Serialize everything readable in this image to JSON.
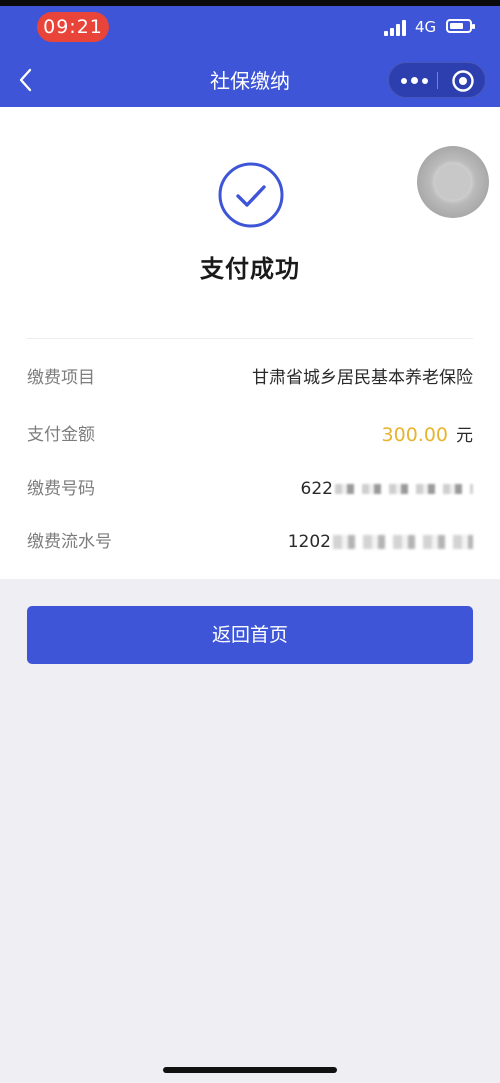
{
  "status_bar": {
    "time": "09:21",
    "network": "4G",
    "time_pill_color": "#e9443a"
  },
  "nav": {
    "title": "社保缴纳",
    "back_icon": "chevron-left-icon",
    "more_icon": "more-dots-icon",
    "close_icon": "target-circle-icon",
    "bar_color": "#3d55d6"
  },
  "result": {
    "icon": "check-circle-icon",
    "title": "支付成功"
  },
  "details": {
    "item_label": "缴费项目",
    "item_value": "甘肃省城乡居民基本养老保险",
    "amount_label": "支付金额",
    "amount_value": "300.00",
    "amount_unit": "元",
    "amount_color": "#e8b42e",
    "number_label": "缴费号码",
    "number_prefix": "622",
    "serial_label": "缴费流水号",
    "serial_prefix": "1202"
  },
  "actions": {
    "return_label": "返回首页"
  }
}
